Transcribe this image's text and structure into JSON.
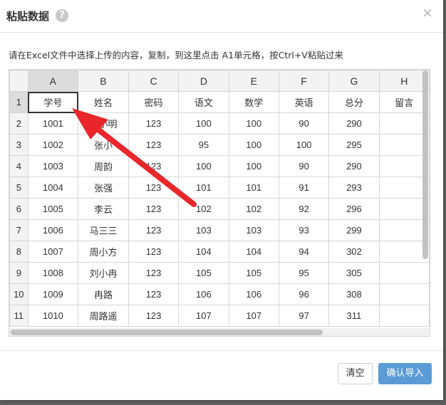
{
  "dialog": {
    "title": "粘贴数据",
    "help_icon": "?",
    "close_icon": "×",
    "instruction": "请在Excel文件中选择上传的内容，复制，到这里点击 A1单元格，按Ctrl+V粘贴过来"
  },
  "sheet": {
    "columns": [
      "A",
      "B",
      "C",
      "D",
      "E",
      "F",
      "G",
      "H"
    ],
    "row_numbers": [
      "1",
      "2",
      "3",
      "4",
      "5",
      "6",
      "7",
      "8",
      "9",
      "10",
      "11"
    ],
    "rows": [
      [
        "学号",
        "姓名",
        "密码",
        "语文",
        "数学",
        "英语",
        "总分",
        "留言"
      ],
      [
        "1001",
        "李小明",
        "123",
        "100",
        "100",
        "90",
        "290",
        ""
      ],
      [
        "1002",
        "张小",
        "123",
        "95",
        "100",
        "100",
        "295",
        ""
      ],
      [
        "1003",
        "周韵",
        "123",
        "100",
        "100",
        "90",
        "290",
        ""
      ],
      [
        "1004",
        "张强",
        "123",
        "101",
        "101",
        "91",
        "293",
        ""
      ],
      [
        "1005",
        "李云",
        "123",
        "102",
        "102",
        "92",
        "296",
        ""
      ],
      [
        "1006",
        "马三三",
        "123",
        "103",
        "103",
        "93",
        "299",
        ""
      ],
      [
        "1007",
        "周小方",
        "123",
        "104",
        "104",
        "94",
        "302",
        ""
      ],
      [
        "1008",
        "刘小冉",
        "123",
        "105",
        "105",
        "95",
        "305",
        ""
      ],
      [
        "1009",
        "冉路",
        "123",
        "106",
        "106",
        "96",
        "308",
        ""
      ],
      [
        "1010",
        "周路遥",
        "123",
        "107",
        "107",
        "97",
        "311",
        ""
      ]
    ],
    "selected_cell": "A1"
  },
  "footer": {
    "clear_label": "清空",
    "confirm_label": "确认导入"
  },
  "colors": {
    "accent": "#5b9bd5",
    "arrow": "#e8262b",
    "header_bg": "#f3f3f3",
    "active_header_bg": "#dcdcdc"
  },
  "icons": {
    "help": "help-icon",
    "close": "close-icon",
    "pointer_arrow": "arrow-icon"
  }
}
